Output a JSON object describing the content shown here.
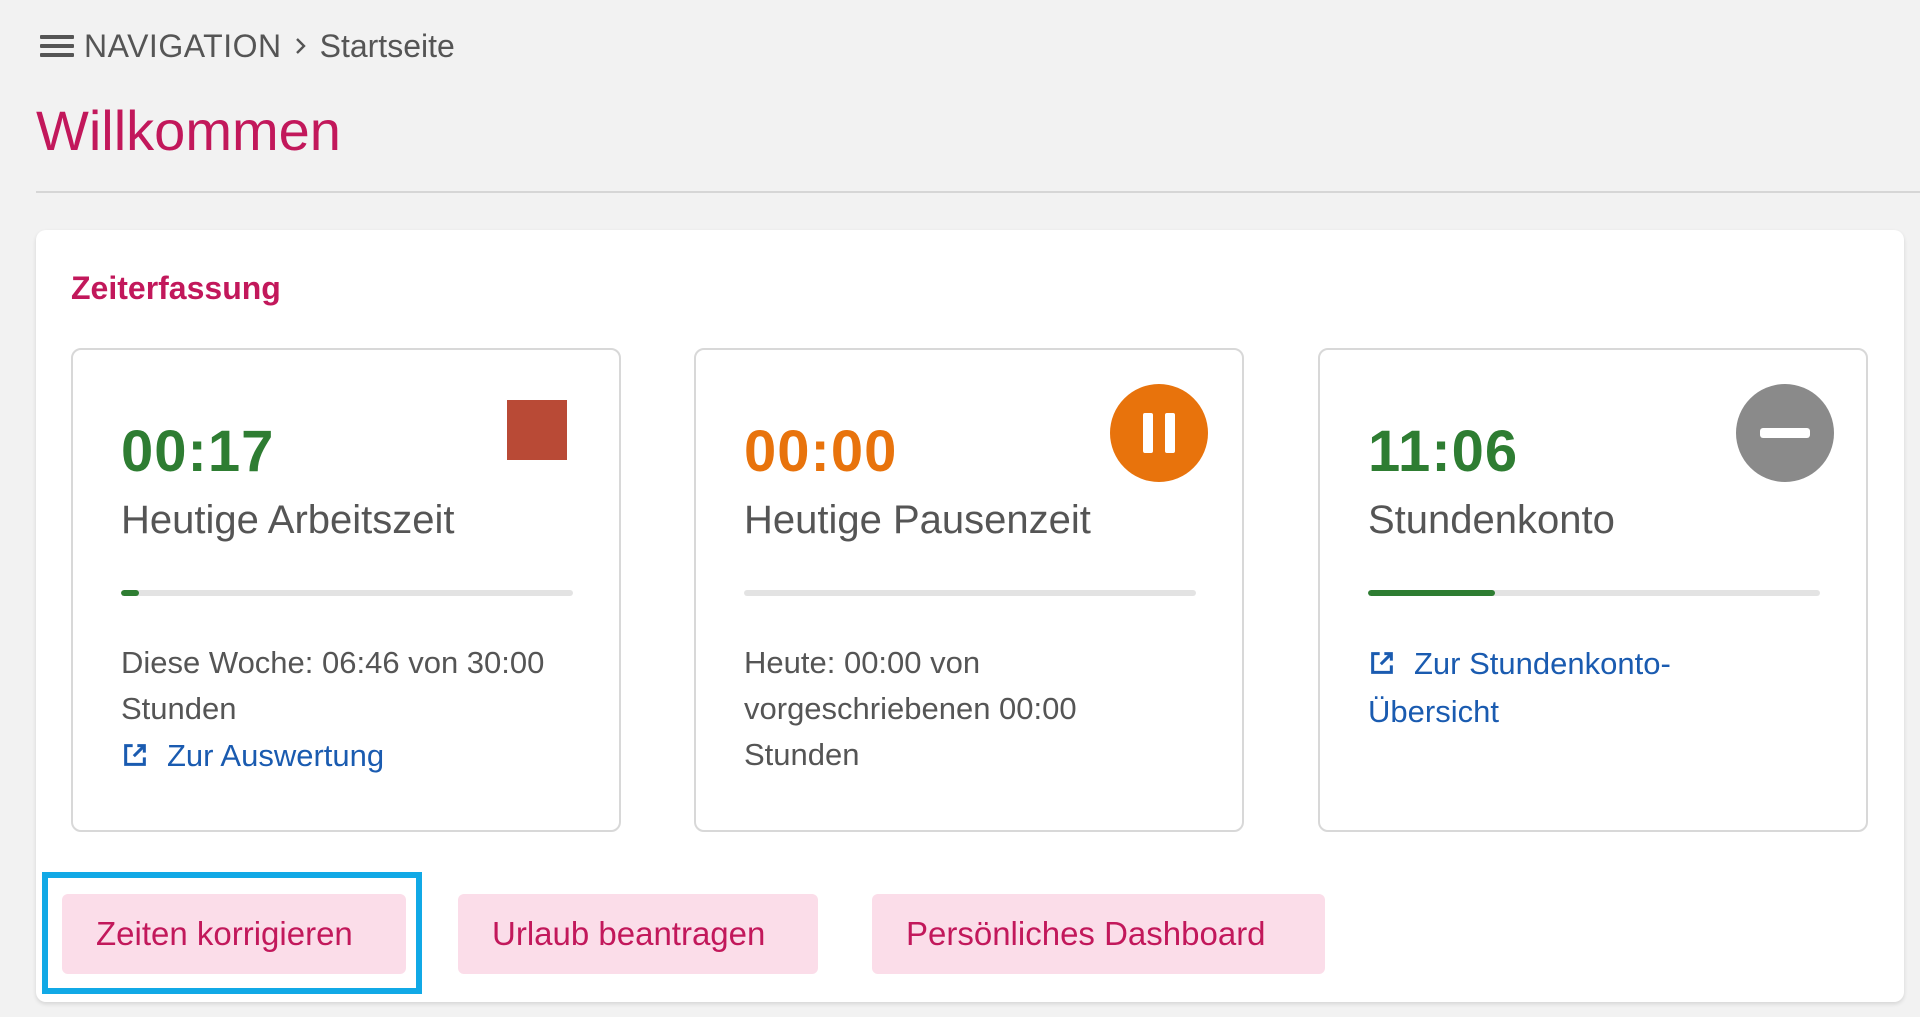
{
  "breadcrumb": {
    "nav_label": "NAVIGATION",
    "current": "Startseite"
  },
  "page": {
    "title": "Willkommen"
  },
  "section": {
    "title": "Zeiterfassung"
  },
  "tiles": [
    {
      "value": "00:17",
      "value_color": "#2e7d32",
      "label": "Heutige Arbeitszeit",
      "progress_fraction": 0.04,
      "progress_color": "#2e7d32",
      "description": "Diese Woche: 06:46 von 30:00 Stunden",
      "link": "Zur Auswertung",
      "action_icon": "stop-icon",
      "action_color": "#b94a36"
    },
    {
      "value": "00:00",
      "value_color": "#e8730c",
      "label": "Heutige Pausenzeit",
      "progress_fraction": 0,
      "progress_color": "#e8730c",
      "description": "Heute: 00:00 von vorgeschriebenen 00:00 Stunden",
      "action_icon": "pause-icon",
      "action_color": "#e8730c"
    },
    {
      "value": "11:06",
      "value_color": "#2e7d32",
      "label": "Stundenkonto",
      "progress_fraction": 0.28,
      "progress_color": "#2e7d32",
      "link": "Zur Stundenkonto-Übersicht",
      "action_icon": "minus-icon",
      "action_color": "#8a8a8a"
    }
  ],
  "actions": {
    "correct_times": "Zeiten korrigieren",
    "request_vacation": "Urlaub beantragen",
    "personal_dashboard": "Persönliches Dashboard"
  },
  "colors": {
    "accent": "#c2185b",
    "button_bg": "#fbdde9",
    "link": "#1a5bb0",
    "focus_ring": "#11a9e6"
  }
}
